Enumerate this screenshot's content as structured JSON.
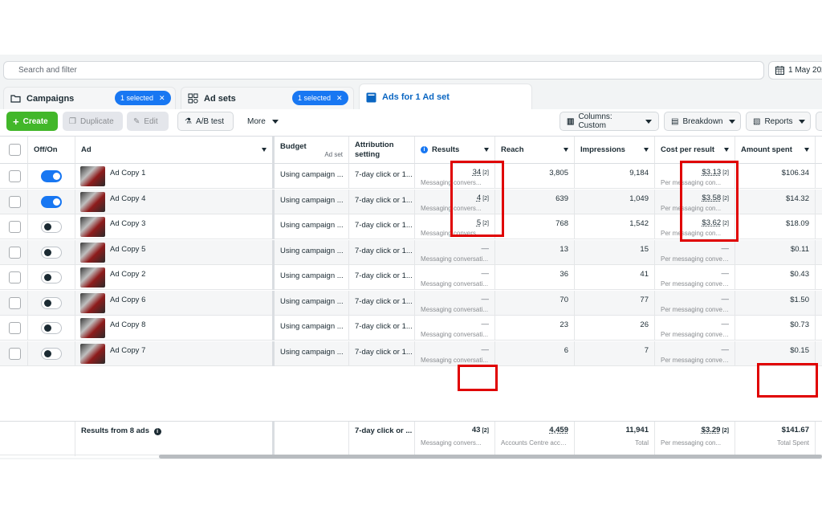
{
  "search": {
    "placeholder": "Search and filter"
  },
  "date_range": "1 May 202",
  "tabs": [
    {
      "label": "Campaigns",
      "pill": "1 selected"
    },
    {
      "label": "Ad sets",
      "pill": "1 selected"
    },
    {
      "label": "Ads for 1 Ad set"
    }
  ],
  "toolbar": {
    "create": "Create",
    "duplicate": "Duplicate",
    "edit": "Edit",
    "ab_test": "A/B test",
    "more": "More",
    "columns": "Columns: Custom",
    "breakdown": "Breakdown",
    "reports": "Reports"
  },
  "columns": {
    "onoff": "Off/On",
    "ad": "Ad",
    "budget": "Budget",
    "budget_sub": "Ad set",
    "attribution": "Attribution setting",
    "results": "Results",
    "reach": "Reach",
    "impressions": "Impressions",
    "cost": "Cost per result",
    "amount": "Amount spent"
  },
  "rows": [
    {
      "name": "Ad Copy 1",
      "on": true,
      "budget": "Using campaign ...",
      "attribution": "7-day click or 1...",
      "results": "34",
      "results_sub": "Messaging convers...",
      "reach": "3,805",
      "impressions": "9,184",
      "cost": "$3.13",
      "cost_sub": "Per messaging con...",
      "amount": "$106.34"
    },
    {
      "name": "Ad Copy 4",
      "on": true,
      "budget": "Using campaign ...",
      "attribution": "7-day click or 1...",
      "results": "4",
      "results_sub": "Messaging convers...",
      "reach": "639",
      "impressions": "1,049",
      "cost": "$3.58",
      "cost_sub": "Per messaging con...",
      "amount": "$14.32"
    },
    {
      "name": "Ad Copy 3",
      "on": false,
      "budget": "Using campaign ...",
      "attribution": "7-day click or 1...",
      "results": "5",
      "results_sub": "Messaging convers...",
      "reach": "768",
      "impressions": "1,542",
      "cost": "$3.62",
      "cost_sub": "Per messaging con...",
      "amount": "$18.09"
    },
    {
      "name": "Ad Copy 5",
      "on": false,
      "budget": "Using campaign ...",
      "attribution": "7-day click or 1...",
      "results": "—",
      "results_sub": "Messaging conversati...",
      "reach": "13",
      "impressions": "15",
      "cost": "—",
      "cost_sub": "Per messaging conver...",
      "amount": "$0.11"
    },
    {
      "name": "Ad Copy 2",
      "on": false,
      "budget": "Using campaign ...",
      "attribution": "7-day click or 1...",
      "results": "—",
      "results_sub": "Messaging conversati...",
      "reach": "36",
      "impressions": "41",
      "cost": "—",
      "cost_sub": "Per messaging conver...",
      "amount": "$0.43"
    },
    {
      "name": "Ad Copy 6",
      "on": false,
      "budget": "Using campaign ...",
      "attribution": "7-day click or 1...",
      "results": "—",
      "results_sub": "Messaging conversati...",
      "reach": "70",
      "impressions": "77",
      "cost": "—",
      "cost_sub": "Per messaging conver...",
      "amount": "$1.50"
    },
    {
      "name": "Ad Copy 8",
      "on": false,
      "budget": "Using campaign ...",
      "attribution": "7-day click or 1...",
      "results": "—",
      "results_sub": "Messaging conversati...",
      "reach": "23",
      "impressions": "26",
      "cost": "—",
      "cost_sub": "Per messaging conver...",
      "amount": "$0.73"
    },
    {
      "name": "Ad Copy 7",
      "on": false,
      "budget": "Using campaign ...",
      "attribution": "7-day click or 1...",
      "results": "—",
      "results_sub": "Messaging conversati...",
      "reach": "6",
      "impressions": "7",
      "cost": "—",
      "cost_sub": "Per messaging conver...",
      "amount": "$0.15"
    }
  ],
  "summary": {
    "label": "Results from 8 ads",
    "attribution": "7-day click or ...",
    "results": "43",
    "results_sub": "Messaging convers...",
    "reach": "4,459",
    "reach_sub": "Accounts Centre acco...",
    "impressions": "11,941",
    "impressions_sub": "Total",
    "cost": "$3.29",
    "cost_sub": "Per messaging con...",
    "amount": "$141.67",
    "amount_sub": "Total Spent"
  },
  "footnote_marker": "[2]",
  "colors": {
    "accent": "#1877f2",
    "create": "#42b72a",
    "highlight": "#e00000"
  }
}
